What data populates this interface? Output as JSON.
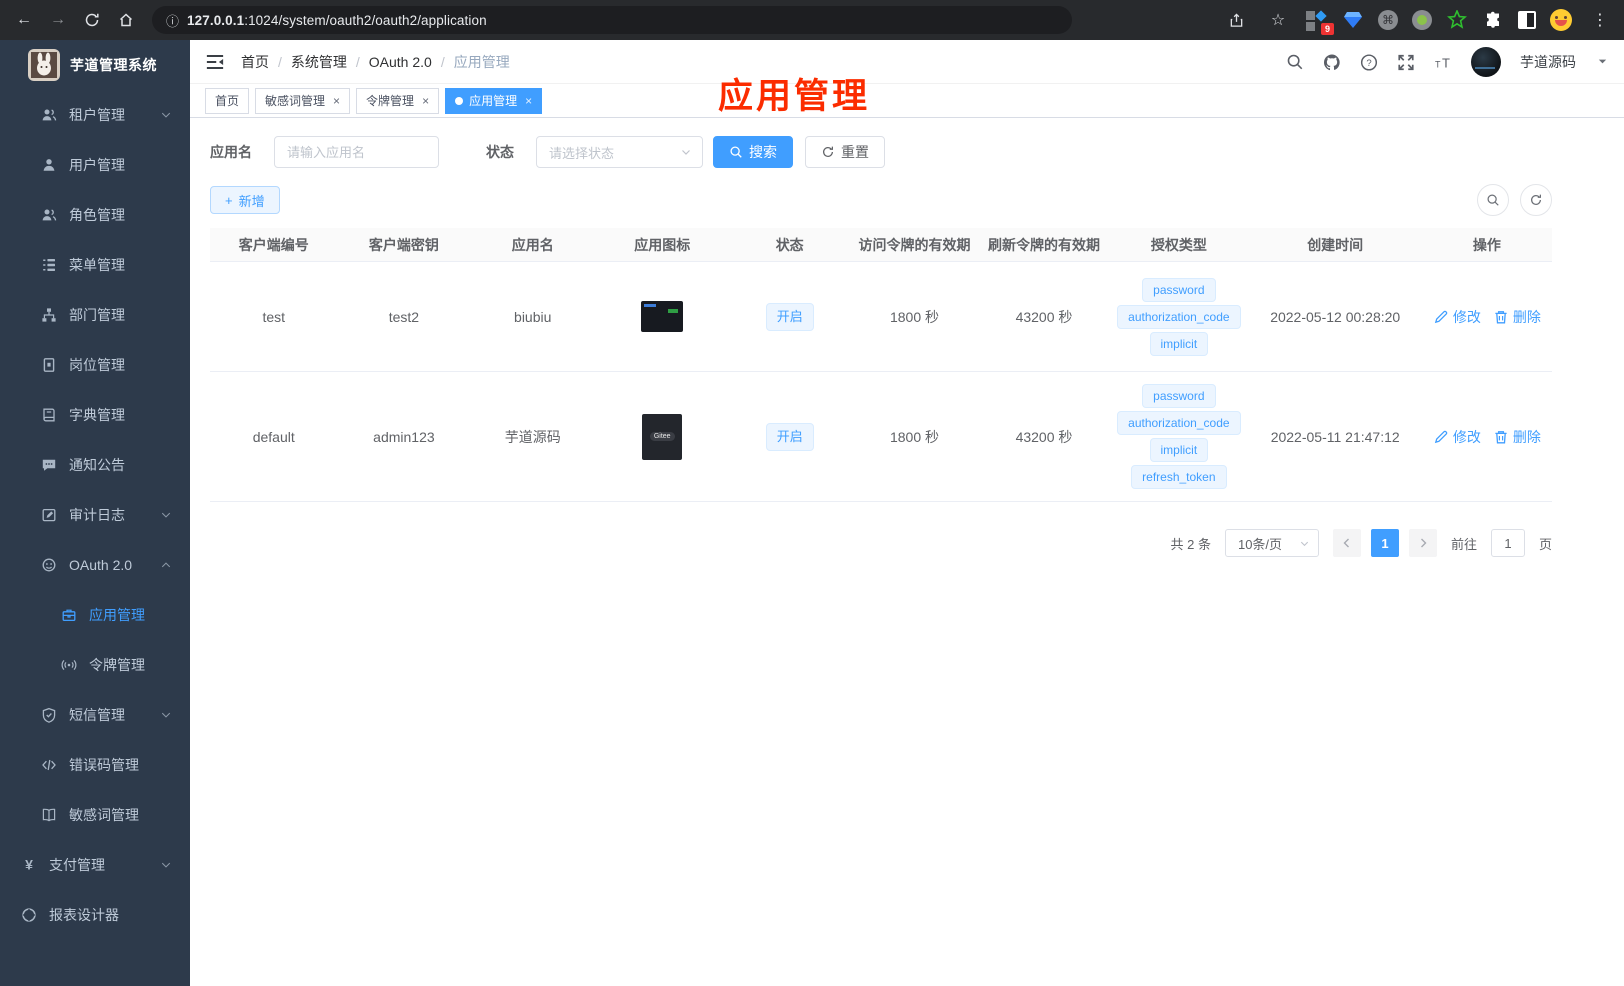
{
  "browser": {
    "url_host": "127.0.0.1",
    "url_rest": ":1024/system/oauth2/oauth2/application",
    "extension_badge": "9"
  },
  "colors": {
    "primary": "#409eff",
    "sidebar_bg": "#2d3a4b",
    "annotation_red": "#fb2c00",
    "tag_bg": "#ecf5ff",
    "tag_text": "#409eff"
  },
  "sidebar": {
    "title": "芋道管理系统",
    "items": [
      {
        "label": "租户管理",
        "icon": "tenant-users-icon",
        "level": 1,
        "arrow": "down"
      },
      {
        "label": "用户管理",
        "icon": "user-icon",
        "level": 1
      },
      {
        "label": "角色管理",
        "icon": "roles-icon",
        "level": 1
      },
      {
        "label": "菜单管理",
        "icon": "menu-tree-icon",
        "level": 1
      },
      {
        "label": "部门管理",
        "icon": "org-tree-icon",
        "level": 1
      },
      {
        "label": "岗位管理",
        "icon": "post-icon",
        "level": 1
      },
      {
        "label": "字典管理",
        "icon": "dict-icon",
        "level": 1
      },
      {
        "label": "通知公告",
        "icon": "notice-icon",
        "level": 1
      },
      {
        "label": "审计日志",
        "icon": "audit-log-icon",
        "level": 1,
        "arrow": "down"
      },
      {
        "label": "OAuth 2.0",
        "icon": "oauth-icon",
        "level": 1,
        "arrow": "up"
      },
      {
        "label": "应用管理",
        "icon": "app-briefcase-icon",
        "level": 2,
        "active": true
      },
      {
        "label": "令牌管理",
        "icon": "token-signal-icon",
        "level": 2
      },
      {
        "label": "短信管理",
        "icon": "sms-shield-icon",
        "level": 1,
        "arrow": "down"
      },
      {
        "label": "错误码管理",
        "icon": "error-code-icon",
        "level": 1
      },
      {
        "label": "敏感词管理",
        "icon": "sensitive-book-icon",
        "level": 1
      },
      {
        "label": "支付管理",
        "icon": "pay-yen-icon",
        "level": 0,
        "arrow": "down"
      },
      {
        "label": "报表设计器",
        "icon": "report-designer-icon",
        "level": 0
      }
    ]
  },
  "header": {
    "breadcrumb": [
      "首页",
      "系统管理",
      "OAuth 2.0",
      "应用管理"
    ],
    "username": "芋道源码"
  },
  "tabs": [
    {
      "label": "首页",
      "closable": false,
      "active": false
    },
    {
      "label": "敏感词管理",
      "closable": true,
      "active": false
    },
    {
      "label": "令牌管理",
      "closable": true,
      "active": false
    },
    {
      "label": "应用管理",
      "closable": true,
      "active": true
    }
  ],
  "annotation": {
    "text": "应用管理"
  },
  "filters": {
    "name_label": "应用名",
    "name_placeholder": "请输入应用名",
    "status_label": "状态",
    "status_placeholder": "请选择状态",
    "search_label": "搜索",
    "reset_label": "重置",
    "add_label": "新增"
  },
  "table": {
    "headers": [
      "客户端编号",
      "客户端密钥",
      "应用名",
      "应用图标",
      "状态",
      "访问令牌的有效期",
      "刷新令牌的有效期",
      "授权类型",
      "创建时间",
      "操作"
    ],
    "edit_label": "修改",
    "delete_label": "删除",
    "rows": [
      {
        "client_id": "test",
        "secret": "test2",
        "name": "biubiu",
        "icon_type": "screenshot-dark",
        "icon_label": "",
        "status": "开启",
        "access_validity": "1800 秒",
        "refresh_validity": "43200 秒",
        "grant_types": [
          "password",
          "authorization_code",
          "implicit"
        ],
        "created": "2022-05-12 00:28:20"
      },
      {
        "client_id": "default",
        "secret": "admin123",
        "name": "芋道源码",
        "icon_type": "gitee-dark",
        "icon_label": "Gitee",
        "status": "开启",
        "access_validity": "1800 秒",
        "refresh_validity": "43200 秒",
        "grant_types": [
          "password",
          "authorization_code",
          "implicit",
          "refresh_token"
        ],
        "created": "2022-05-11 21:47:12"
      }
    ]
  },
  "pagination": {
    "total": "共 2 条",
    "page_size": "10条/页",
    "current_page": "1",
    "goto_label": "前往",
    "goto_value": "1",
    "page_label": "页"
  }
}
